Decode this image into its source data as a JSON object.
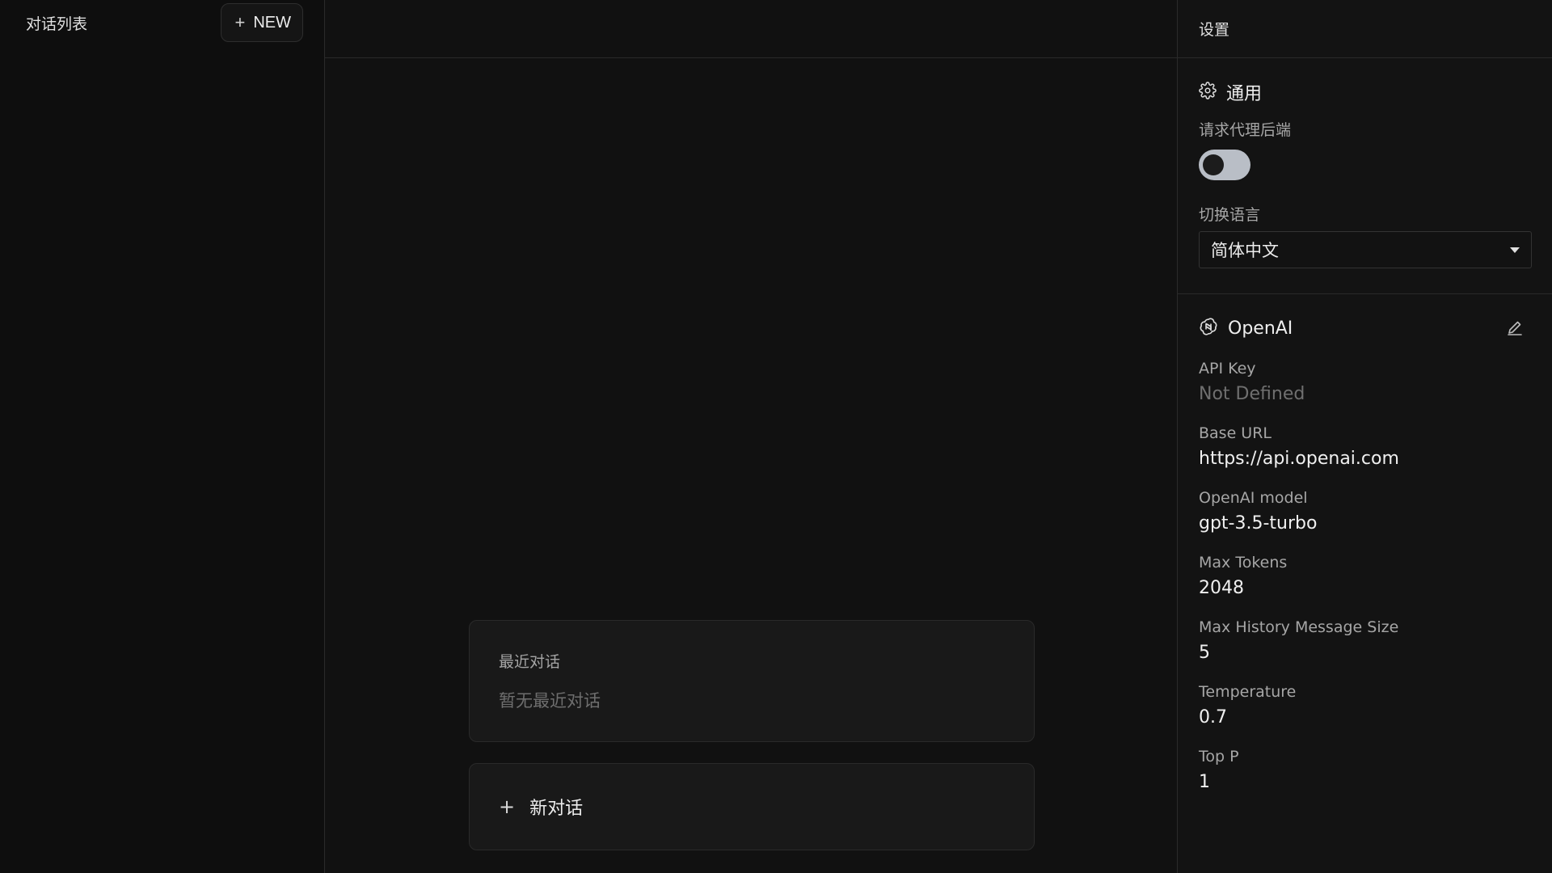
{
  "sidebar": {
    "title": "对话列表",
    "new_button": "NEW"
  },
  "main": {
    "recent": {
      "title": "最近对话",
      "empty": "暂无最近对话"
    },
    "new_chat": "新对话"
  },
  "settings": {
    "title": "设置",
    "general": {
      "heading": "通用",
      "proxy_label": "请求代理后端",
      "proxy_enabled": false,
      "language_label": "切换语言",
      "language_value": "简体中文"
    },
    "openai": {
      "heading": "OpenAI",
      "fields": [
        {
          "label": "API Key",
          "value": "Not Defined"
        },
        {
          "label": "Base URL",
          "value": "https://api.openai.com"
        },
        {
          "label": "OpenAI model",
          "value": "gpt-3.5-turbo"
        },
        {
          "label": "Max Tokens",
          "value": "2048"
        },
        {
          "label": "Max History Message Size",
          "value": "5"
        },
        {
          "label": "Temperature",
          "value": "0.7"
        },
        {
          "label": "Top P",
          "value": "1"
        }
      ]
    }
  },
  "icons": {
    "gear": "gear-icon",
    "openai": "openai-logo-icon",
    "edit": "pencil-icon",
    "plus": "plus-icon",
    "caret": "caret-down-icon"
  }
}
